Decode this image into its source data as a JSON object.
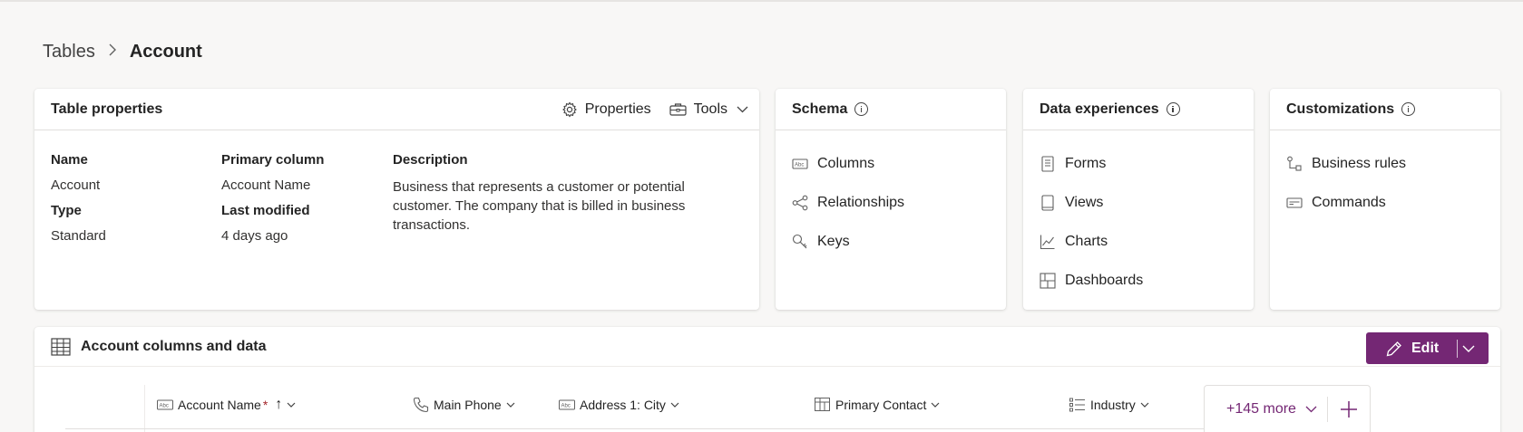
{
  "breadcrumb": {
    "parent": "Tables",
    "separator": ">",
    "current": "Account"
  },
  "table_properties": {
    "title": "Table properties",
    "properties_label": "Properties",
    "tools_label": "Tools",
    "name_label": "Name",
    "name_value": "Account",
    "type_label": "Type",
    "type_value": "Standard",
    "primary_column_label": "Primary column",
    "primary_column_value": "Account Name",
    "last_modified_label": "Last modified",
    "last_modified_value": "4 days ago",
    "description_label": "Description",
    "description_value": "Business that represents a customer or potential customer. The company that is billed in business transactions."
  },
  "schema": {
    "title": "Schema",
    "items": [
      "Columns",
      "Relationships",
      "Keys"
    ]
  },
  "data_experiences": {
    "title": "Data experiences",
    "items": [
      "Forms",
      "Views",
      "Charts",
      "Dashboards"
    ]
  },
  "customizations": {
    "title": "Customizations",
    "items": [
      "Business rules",
      "Commands"
    ]
  },
  "grid": {
    "title": "Account columns and data",
    "edit_label": "Edit",
    "columns": {
      "account_name": "Account Name",
      "required_mark": "*",
      "sort_indicator": "↑",
      "main_phone": "Main Phone",
      "city": "Address 1: City",
      "primary_contact": "Primary Contact",
      "industry": "Industry"
    },
    "more_columns": "+145 more",
    "add_column": "+"
  },
  "colors": {
    "accent": "#742774",
    "background": "#f8f7f6",
    "required": "#a4262c"
  }
}
